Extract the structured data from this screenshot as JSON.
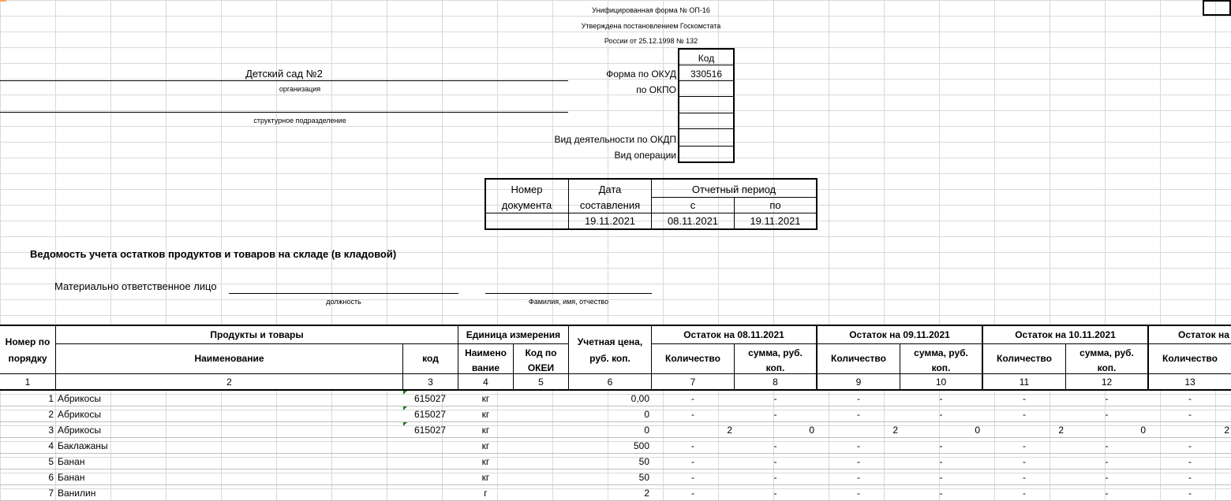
{
  "header": {
    "form_line1": "Унифицированная форма № ОП-16",
    "form_line2": "Утверждена постановлением Госкомстата",
    "form_line3": "России от 25.12.1998 № 132",
    "kod_label": "Код",
    "okud_label": "Форма по ОКУД",
    "okud_value": "330516",
    "okpo_label": "по ОКПО",
    "okdp_label": "Вид деятельности по ОКДП",
    "vid_oper_label": "Вид операции",
    "organization": "Детский сад №2",
    "organization_caption": "организация",
    "division_caption": "структурное подразделение"
  },
  "doc_table": {
    "col1_line1": "Номер",
    "col1_line2": "документа",
    "col2_line1": "Дата",
    "col2_line2": "составления",
    "period": "Отчетный период",
    "from": "с",
    "to": "по",
    "date_composed": "19.11.2021",
    "date_from": "08.11.2021",
    "date_to": "19.11.2021"
  },
  "title": "Ведомость  учета остатков продуктов и товаров на складе (в кладовой)",
  "responsible": {
    "label": "Материально ответственное лицо",
    "position_caption": "должность",
    "name_caption": "Фамилия, имя, отчество"
  },
  "table_header": {
    "num1": "Номер по",
    "num2": "порядку",
    "products": "Продукты и товары",
    "name": "Наименование",
    "code": "код",
    "unit": "Единица измерения",
    "unit_name1": "Наимено",
    "unit_name2": "вание",
    "okei1": "Код по",
    "okei2": "ОКЕИ",
    "price1": "Учетная цена,",
    "price2": "руб. коп.",
    "rest1": "Остаток на 08.11.2021",
    "rest2": "Остаток на 09.11.2021",
    "rest3": "Остаток на 10.11.2021",
    "rest4": "Остаток на",
    "qty": "Количество",
    "sum1": "сумма, руб.",
    "sum2": "коп.",
    "colnums": [
      "1",
      "2",
      "3",
      "4",
      "5",
      "6",
      "7",
      "8",
      "9",
      "10",
      "11",
      "12",
      "13"
    ]
  },
  "rows": [
    {
      "n": "1",
      "name": "Абрикосы",
      "code": "615027",
      "unit": "кг",
      "price": "0,00",
      "q1": "-",
      "s1": "-",
      "q2": "-",
      "s2": "-",
      "q3": "-",
      "s3": "-",
      "q4": "-"
    },
    {
      "n": "2",
      "name": "Абрикосы",
      "code": "615027",
      "unit": "кг",
      "price": "0",
      "q1": "-",
      "s1": "-",
      "q2": "-",
      "s2": "-",
      "q3": "-",
      "s3": "-",
      "q4": "-"
    },
    {
      "n": "3",
      "name": "Абрикосы",
      "code": "615027",
      "unit": "кг",
      "price": "0",
      "q1": "2",
      "s1": "0",
      "q2": "2",
      "s2": "0",
      "q3": "2",
      "s3": "0",
      "q4": "2"
    },
    {
      "n": "4",
      "name": "Баклажаны",
      "code": "",
      "unit": "кг",
      "price": "500",
      "q1": "-",
      "s1": "-",
      "q2": "-",
      "s2": "-",
      "q3": "-",
      "s3": "-",
      "q4": "-"
    },
    {
      "n": "5",
      "name": "Банан",
      "code": "",
      "unit": "кг",
      "price": "50",
      "q1": "-",
      "s1": "-",
      "q2": "-",
      "s2": "-",
      "q3": "-",
      "s3": "-",
      "q4": "-"
    },
    {
      "n": "6",
      "name": "Банан",
      "code": "",
      "unit": "кг",
      "price": "50",
      "q1": "-",
      "s1": "-",
      "q2": "-",
      "s2": "-",
      "q3": "-",
      "s3": "-",
      "q4": "-"
    },
    {
      "n": "7",
      "name": "Ванилин",
      "code": "",
      "unit": "г",
      "price": "2",
      "q1": "-",
      "s1": "-",
      "q2": "-",
      "s2": "-",
      "q3": "-",
      "s3": "-",
      "q4": "-"
    }
  ]
}
